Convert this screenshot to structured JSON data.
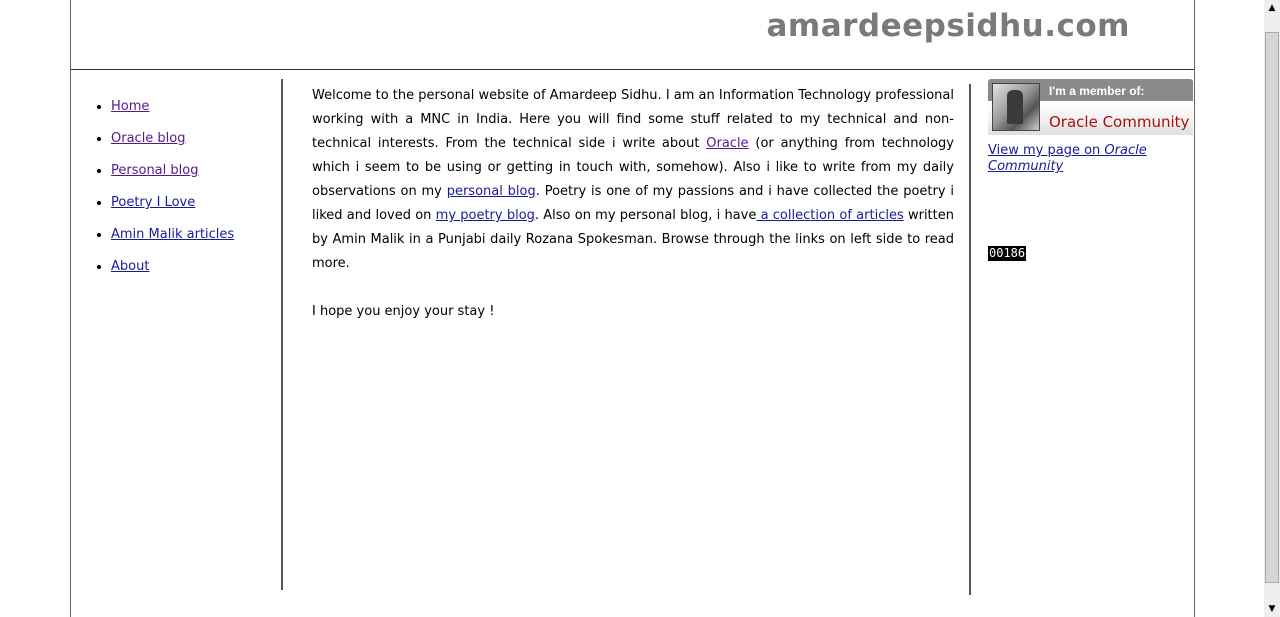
{
  "header": {
    "site_title": "amardeepsidhu.com"
  },
  "nav": {
    "items": [
      {
        "label": "Home"
      },
      {
        "label": "Oracle blog"
      },
      {
        "label": "Personal blog"
      },
      {
        "label": "Poetry I Love"
      },
      {
        "label": "Amin Malik articles"
      },
      {
        "label": "About"
      }
    ]
  },
  "content": {
    "intro_1": "Welcome to the personal website of Amardeep Sidhu. I am an Information Technology professional working with a MNC in India. Here you will find some stuff related to my technical and non-technical interests. From the technical side i write about ",
    "link_oracle": "Oracle",
    "intro_2": " (or anything from technology which i seem to be using or getting in touch with, somehow). Also i like to write from my daily observations on my ",
    "link_personal_blog": "personal blog",
    "intro_3": ". Poetry is one of my passions and i have collected the poetry i liked and loved on ",
    "link_poetry_blog": "my poetry blog",
    "intro_4": ". Also on my personal blog, i have",
    "link_articles": " a collection of articles",
    "intro_5": " written by Amin Malik in a Punjabi daily Rozana Spokesman. Browse through the links on left side to read more.",
    "closing": "I hope you enjoy your stay !"
  },
  "sidebar": {
    "badge_header": "I'm a member of:",
    "badge_community": "Oracle Community",
    "view_link_prefix": "View my page on ",
    "view_link_emph": "Oracle Community",
    "counter": "00186"
  },
  "scrollbar": {
    "up_icon": "▲",
    "down_icon": "▼"
  }
}
